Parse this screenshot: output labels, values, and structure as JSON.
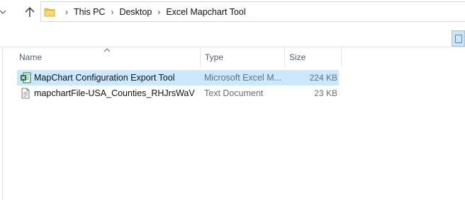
{
  "breadcrumb": {
    "items": [
      "This PC",
      "Desktop",
      "Excel Mapchart Tool"
    ],
    "separator": "›"
  },
  "columns": {
    "name": "Name",
    "type": "Type",
    "size": "Size"
  },
  "files": [
    {
      "name": "MapChart Configuration Export Tool",
      "type": "Microsoft Excel M...",
      "size": "224 KB",
      "icon": "excel-file-icon",
      "selected": true
    },
    {
      "name": "mapchartFile-USA_Counties_RHJrsWaV",
      "type": "Text Document",
      "size": "23 KB",
      "icon": "text-file-icon",
      "selected": false
    }
  ],
  "colors": {
    "selection": "#cce8ff",
    "header_text": "#4c607a",
    "excel_green": "#1d6f42",
    "folder_yellow": "#f3c94f"
  }
}
